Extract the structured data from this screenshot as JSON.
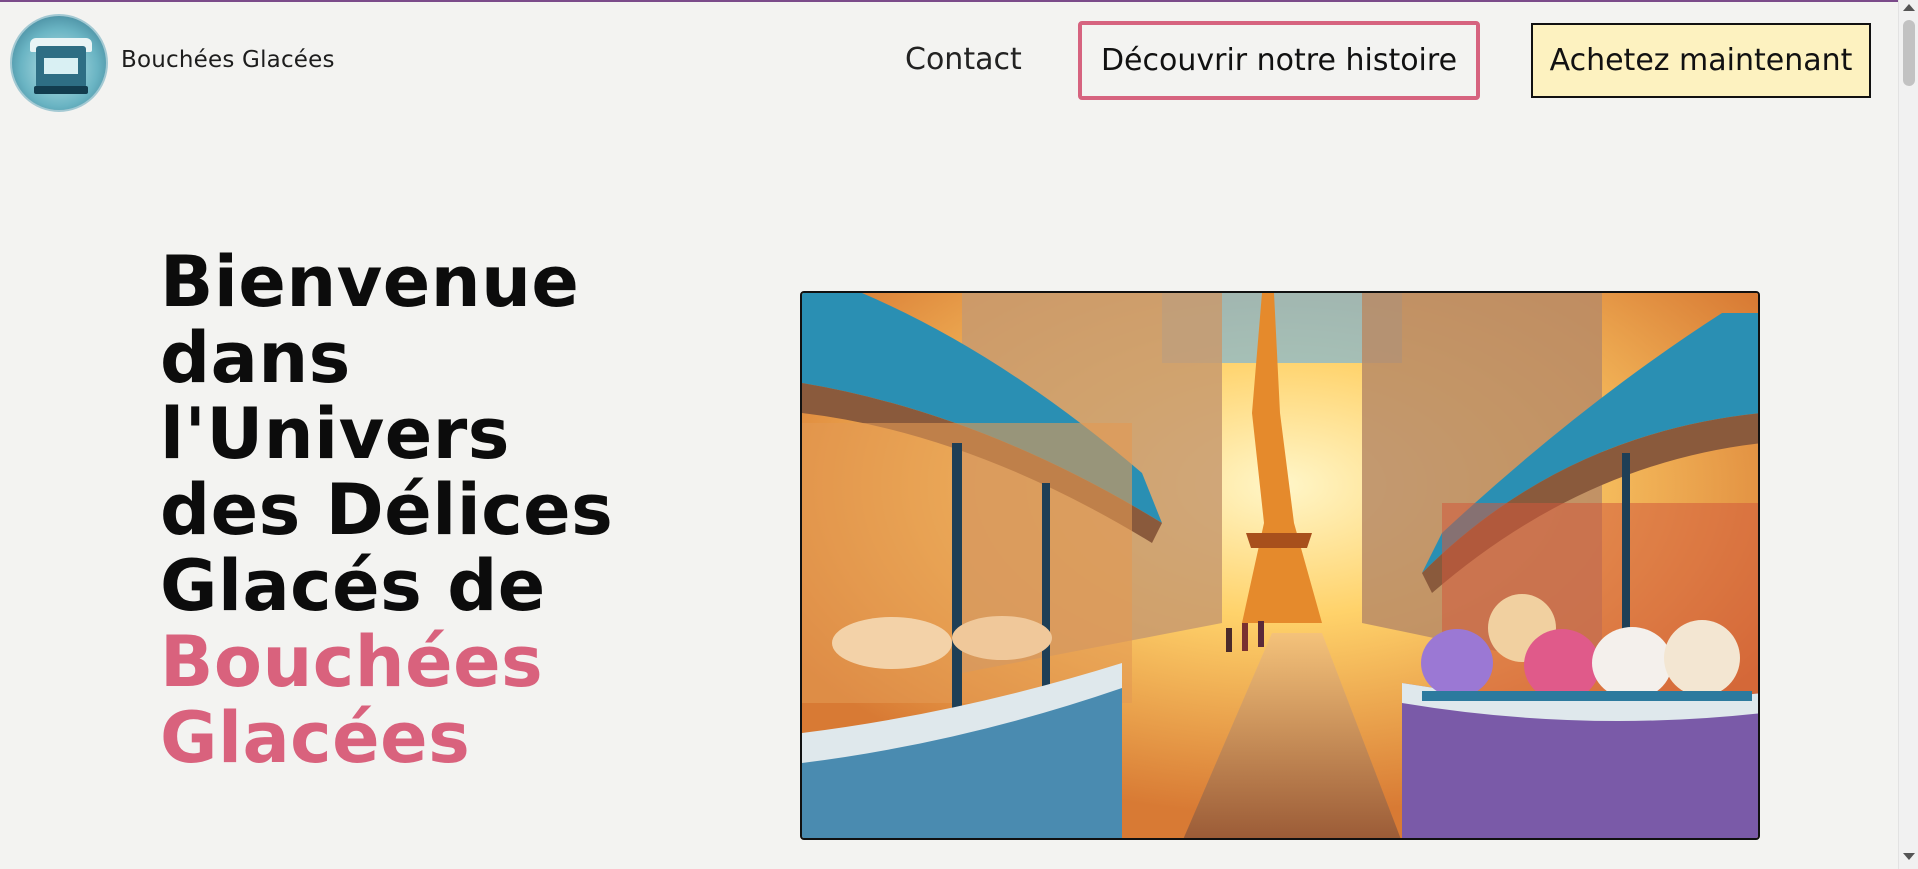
{
  "header": {
    "brand": "Bouchées Glacées",
    "nav_contact": "Contact",
    "btn_story": "Découvrir notre histoire",
    "btn_buy": "Achetez maintenant"
  },
  "hero": {
    "title_lines": [
      "Bienvenue",
      "dans",
      "l'Univers",
      "des Délices",
      "Glacés de"
    ],
    "title_accent_lines": [
      "Bouchées",
      "Glacées"
    ]
  },
  "colors": {
    "accent": "#d9627d",
    "buy_button_bg": "#fdf2c0",
    "background": "#f3f3f1"
  },
  "icons": {
    "logo": "ice-cream-shop-logo-icon"
  }
}
